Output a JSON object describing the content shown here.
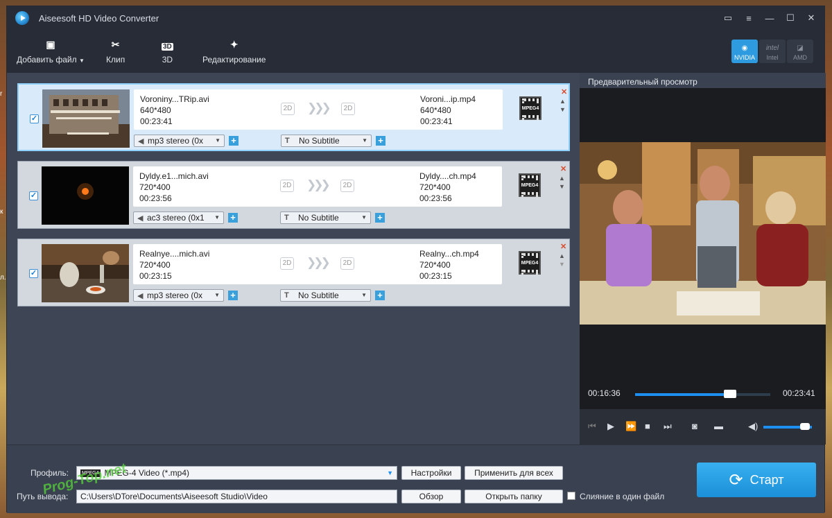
{
  "app": {
    "title": "Aiseesoft HD Video Converter"
  },
  "window_controls": [
    "feedback-icon",
    "menu-icon",
    "minimize-icon",
    "maximize-icon",
    "close-icon"
  ],
  "toolbar": {
    "add_file": "Добавить файл",
    "clip": "Клип",
    "three_d": "3D",
    "three_d_icon": "3D",
    "edit": "Редактирование"
  },
  "gpu": {
    "nvidia": "NVIDIA",
    "intel": "Intel",
    "amd": "AMD",
    "intel_mark": "intel",
    "active": "NVIDIA"
  },
  "files": [
    {
      "src_name": "Voroniny...TRip.avi",
      "src_res": "640*480",
      "src_dur": "00:23:41",
      "src_mode": "2D",
      "dst_mode": "2D",
      "dst_name": "Voroni...ip.mp4",
      "dst_res": "640*480",
      "dst_dur": "00:23:41",
      "audio": "mp3 stereo (0x",
      "subtitle": "No Subtitle",
      "checked": true,
      "selected": true
    },
    {
      "src_name": "Dyldy.e1...mich.avi",
      "src_res": "720*400",
      "src_dur": "00:23:56",
      "src_mode": "2D",
      "dst_mode": "2D",
      "dst_name": "Dyldy....ch.mp4",
      "dst_res": "720*400",
      "dst_dur": "00:23:56",
      "audio": "ac3 stereo (0x1",
      "subtitle": "No Subtitle",
      "checked": true,
      "selected": false
    },
    {
      "src_name": "Realnye....mich.avi",
      "src_res": "720*400",
      "src_dur": "00:23:15",
      "src_mode": "2D",
      "dst_mode": "2D",
      "dst_name": "Realny...ch.mp4",
      "dst_res": "720*400",
      "dst_dur": "00:23:15",
      "audio": "mp3 stereo (0x",
      "subtitle": "No Subtitle",
      "checked": true,
      "selected": false
    }
  ],
  "format_icon_text": "MPEG4",
  "preview": {
    "title": "Предварительный просмотр",
    "current": "00:16:36",
    "total": "00:23:41",
    "progress": 0.7,
    "volume": 0.85
  },
  "bottom": {
    "profile_label": "Профиль:",
    "profile_value": "MPEG-4 Video (*.mp4)",
    "settings": "Настройки",
    "apply_all": "Применить для всех",
    "output_label": "Путь вывода:",
    "output_value": "C:\\Users\\DTore\\Documents\\Aiseesoft Studio\\Video",
    "browse": "Обзор",
    "open_folder": "Открыть папку",
    "merge": "Слияние в один файл",
    "start": "Старт"
  },
  "watermark": "Prog-Top.net",
  "colors": {
    "accent": "#1c8ff0",
    "toolbar": "#272c36",
    "panel": "#3a4150",
    "selected_item": "#d9ebfb"
  }
}
